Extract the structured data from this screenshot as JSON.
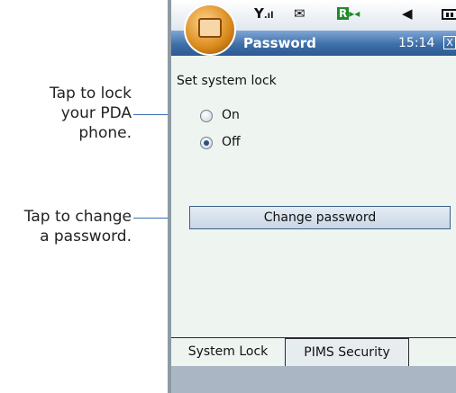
{
  "callouts": {
    "lock_line1": "Tap to lock",
    "lock_line2": "your PDA",
    "lock_line3": "phone.",
    "change_line1": "Tap to change",
    "change_line2": "a password."
  },
  "status_bar": {
    "signal_icon": "signal-strength",
    "message_icon": "envelope",
    "network_icon": "roaming-indicator",
    "volume_icon": "speaker",
    "battery_icon": "battery"
  },
  "title_bar": {
    "title": "Password",
    "time": "15:14",
    "close": "X"
  },
  "content": {
    "section_label": "Set system lock",
    "options": [
      {
        "label": "On",
        "selected": false
      },
      {
        "label": "Off",
        "selected": true
      }
    ],
    "change_password_button": "Change password"
  },
  "tabs": [
    {
      "label": "System Lock",
      "active": true
    },
    {
      "label": "PIMS Security",
      "active": false
    }
  ],
  "colors": {
    "title_bar": "#3f6fa8",
    "content_bg": "#eef5f1",
    "leader_line": "#3a6fb0"
  }
}
